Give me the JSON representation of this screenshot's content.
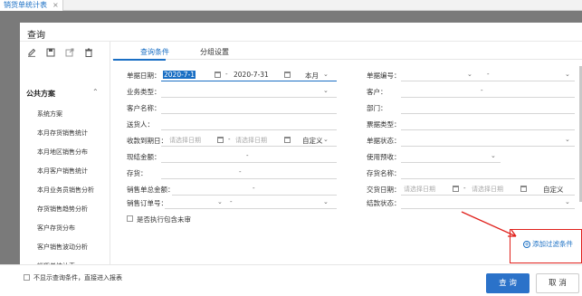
{
  "app": {
    "tab_label": "销货单统计表",
    "tab_close": "×"
  },
  "dialog": {
    "title": "查询"
  },
  "left_panel": {
    "tools": [
      {
        "icon": "edit-icon"
      },
      {
        "icon": "save-icon"
      },
      {
        "icon": "export-icon"
      },
      {
        "icon": "delete-icon"
      }
    ],
    "section_title": "公共方案",
    "section_chevron": "⌃",
    "items": [
      "系统方案",
      "本月存货销售统计",
      "本月地区销售分布",
      "本月客户销售统计",
      "本月业务员销售分析",
      "存货销售趋势分析",
      "客户存货分布",
      "客户销售波动分析",
      "销货单统计表"
    ],
    "collapse_icon": "«"
  },
  "tabs": {
    "query": "查询条件",
    "group": "分组设置"
  },
  "fields": {
    "bill_date_label": "单据日期：",
    "bill_date_from": "2020-7-1",
    "bill_date_to": "2020-7-31",
    "bill_date_range": "本月",
    "date_sep": "-",
    "bill_no_label": "单据编号：",
    "bill_no_sep": "-",
    "biz_type_label": "业务类型：",
    "customer_label": "客户：",
    "customer_sep": "-",
    "customer_name_label": "客户名称：",
    "dept_label": "部门：",
    "shipper_label": "送货人：",
    "invoice_type_label": "票据类型：",
    "due_date_label": "收款到期日：",
    "due_date_from_ph": "请选择日期",
    "due_date_to_ph": "请选择日期",
    "due_date_range": "自定义",
    "bill_status_label": "单据状态：",
    "settle_amt_label": "现结金额：",
    "settle_sep": "-",
    "use_prepay_label": "使用预收：",
    "stock_label": "存货：",
    "stock_sep": "-",
    "stock_name_label": "存货名称：",
    "total_amt_label": "销售单总金额：",
    "total_sep": "-",
    "trade_date_label": "交货日期：",
    "trade_date_from_ph": "请选择日期",
    "trade_date_to_ph": "请选择日期",
    "trade_date_range": "自定义",
    "order_no_label": "销售订单号：",
    "order_sep": "-",
    "settle_status_label": "结款状态：",
    "include_exec_label": "是否执行包含未审"
  },
  "add_filter": "添加过滤条件",
  "footer": {
    "no_show_label": "不显示查询条件，直接进入报表",
    "query_button": "查 询",
    "cancel_button": "取 消"
  },
  "colors": {
    "accent": "#1a6fc4",
    "highlight": "#e0201b"
  }
}
